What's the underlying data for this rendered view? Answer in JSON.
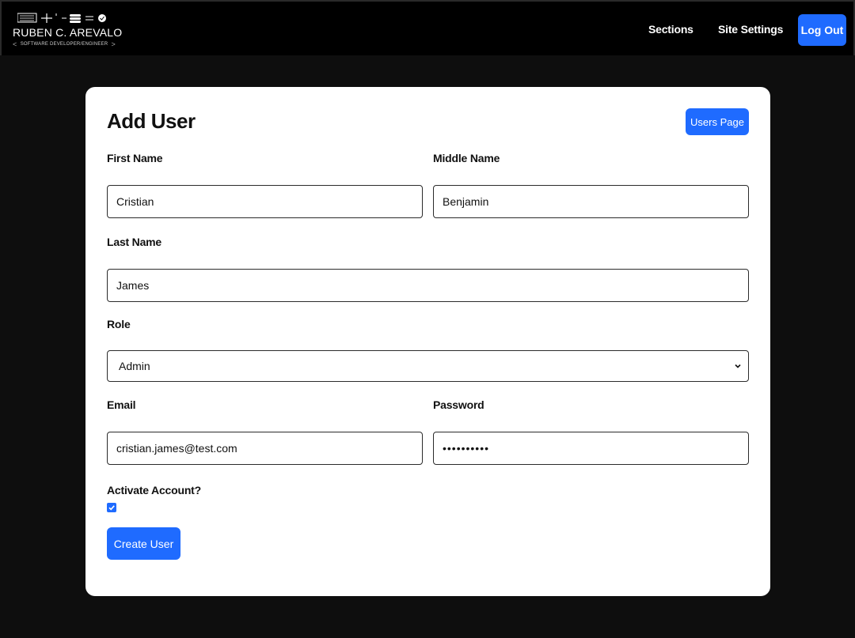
{
  "header": {
    "logo_name": "RUBEN C. AREVALO",
    "logo_tagline": "SOFTWARE DEVELOPER/ENGINEER",
    "nav": {
      "sections": "Sections",
      "site_settings": "Site Settings",
      "logout": "Log Out"
    }
  },
  "form": {
    "title": "Add User",
    "users_page_button": "Users Page",
    "first_name": {
      "label": "First Name",
      "value": "Cristian"
    },
    "middle_name": {
      "label": "Middle Name",
      "value": "Benjamin"
    },
    "last_name": {
      "label": "Last Name",
      "value": "James"
    },
    "role": {
      "label": "Role",
      "value": "Admin"
    },
    "email": {
      "label": "Email",
      "value": "cristian.james@test.com"
    },
    "password": {
      "label": "Password",
      "masked_value": "••••••••••"
    },
    "activate": {
      "label": "Activate Account?",
      "checked": true
    },
    "submit_label": "Create User"
  },
  "colors": {
    "accent": "#1f6bff",
    "page_bg": "#0e0e0e",
    "header_bg": "#000000",
    "card_bg": "#ffffff"
  }
}
